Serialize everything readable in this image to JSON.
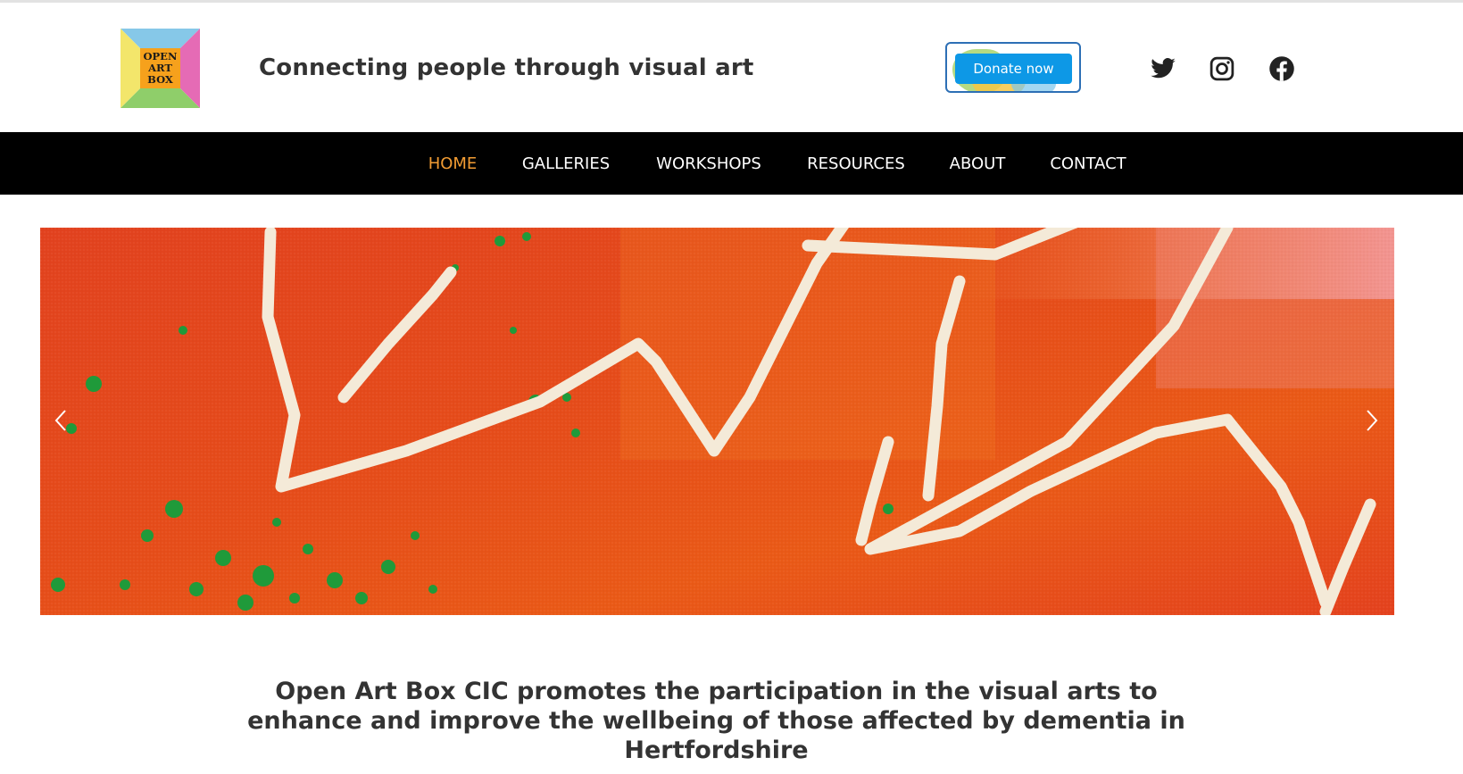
{
  "header": {
    "logo": {
      "lines": [
        "OPEN",
        "ART",
        "BOX"
      ]
    },
    "tagline": "Connecting people through visual art",
    "donate_label": "Donate now",
    "social": [
      {
        "icon": "twitter-icon"
      },
      {
        "icon": "instagram-icon"
      },
      {
        "icon": "facebook-icon"
      }
    ]
  },
  "nav": {
    "items": [
      {
        "label": "HOME",
        "active": true
      },
      {
        "label": "GALLERIES",
        "active": false
      },
      {
        "label": "WORKSHOPS",
        "active": false
      },
      {
        "label": "RESOURCES",
        "active": false
      },
      {
        "label": "ABOUT",
        "active": false
      },
      {
        "label": "CONTACT",
        "active": false
      }
    ]
  },
  "hero": {
    "prev_icon": "chevron-left-icon",
    "next_icon": "chevron-right-icon"
  },
  "mission": {
    "text": "Open Art Box CIC promotes the participation in the visual arts to enhance and improve the wellbeing of those affected by dementia in Hertfordshire"
  },
  "colors": {
    "nav_background": "#000000",
    "nav_active": "#f29c33",
    "donate_button": "#0d98e6",
    "hero_base": "#e7431d",
    "text": "#333333"
  }
}
